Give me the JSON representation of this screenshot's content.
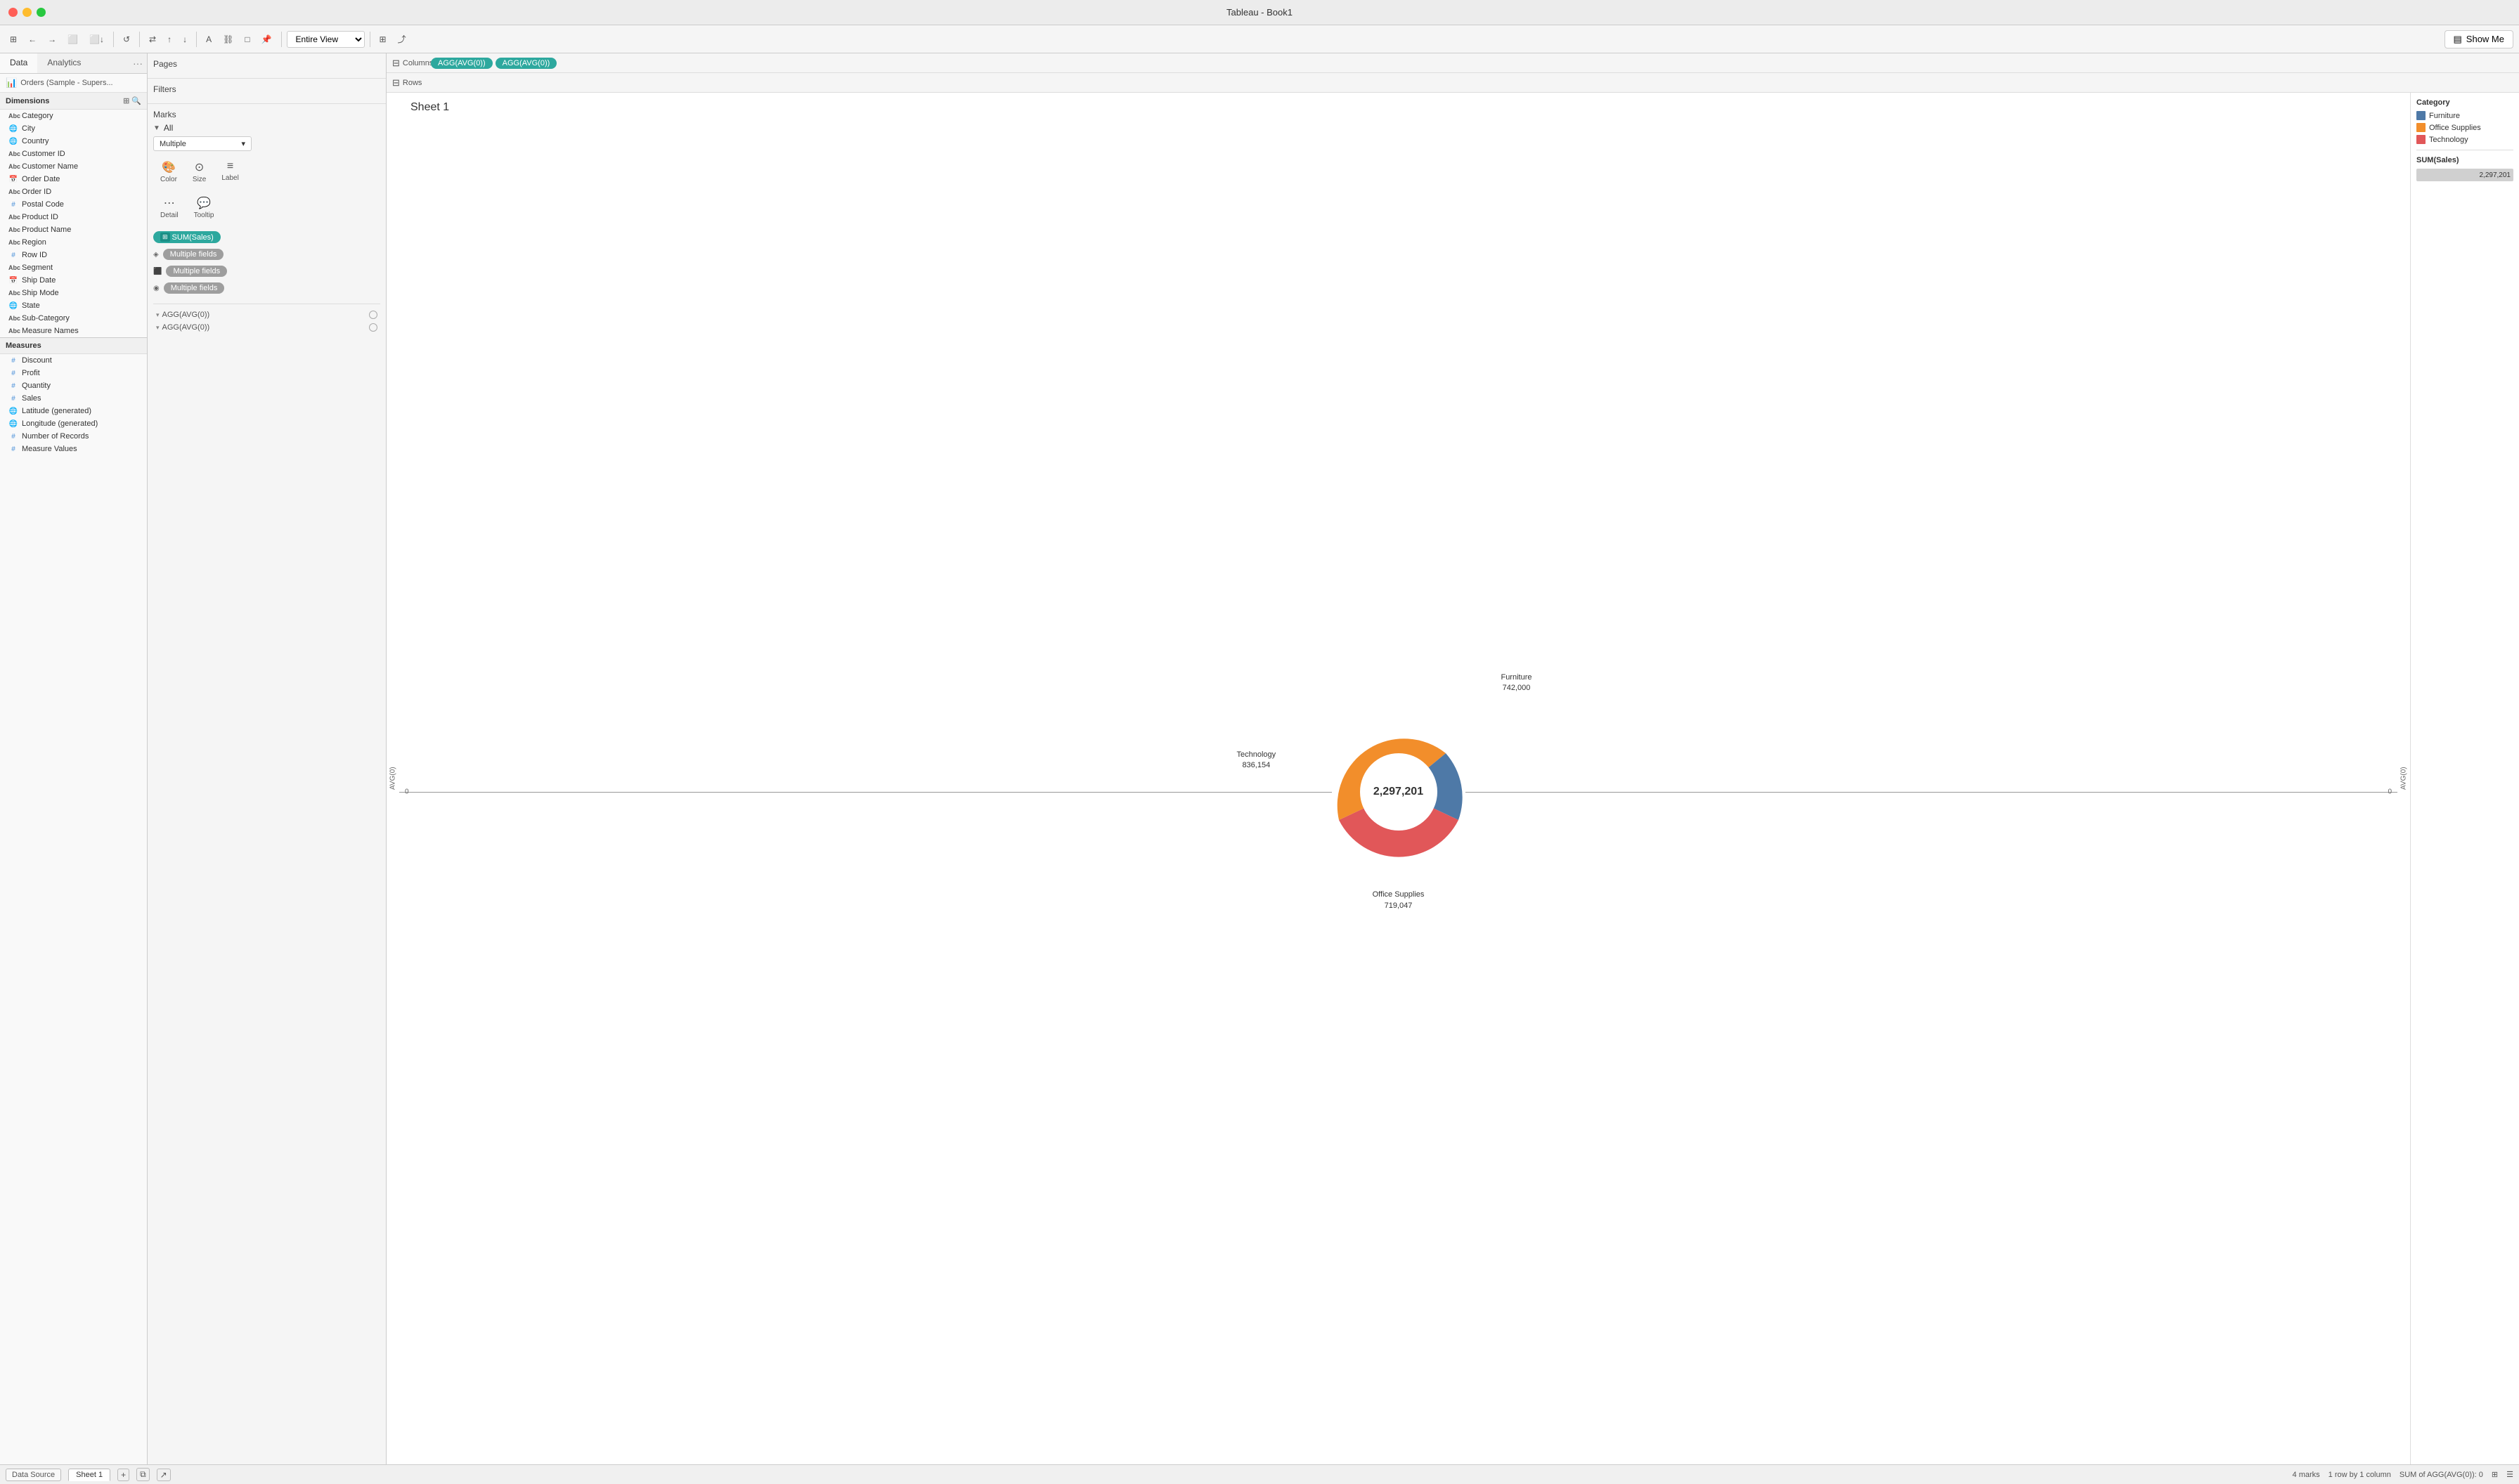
{
  "window": {
    "title": "Tableau - Book1"
  },
  "tabs": {
    "data_label": "Data",
    "analytics_label": "Analytics"
  },
  "data_source": {
    "name": "Orders (Sample - Supers..."
  },
  "dimensions": {
    "header": "Dimensions",
    "items": [
      {
        "type": "abc",
        "label": "Category"
      },
      {
        "type": "globe",
        "label": "City"
      },
      {
        "type": "globe",
        "label": "Country"
      },
      {
        "type": "abc",
        "label": "Customer ID"
      },
      {
        "type": "abc",
        "label": "Customer Name"
      },
      {
        "type": "calendar",
        "label": "Order Date"
      },
      {
        "type": "abc",
        "label": "Order ID"
      },
      {
        "type": "hash-blue",
        "label": "Postal Code"
      },
      {
        "type": "abc",
        "label": "Product ID"
      },
      {
        "type": "abc",
        "label": "Product Name"
      },
      {
        "type": "abc",
        "label": "Region"
      },
      {
        "type": "hash-blue",
        "label": "Row ID"
      },
      {
        "type": "abc",
        "label": "Segment"
      },
      {
        "type": "calendar",
        "label": "Ship Date"
      },
      {
        "type": "abc",
        "label": "Ship Mode"
      },
      {
        "type": "globe",
        "label": "State"
      },
      {
        "type": "abc",
        "label": "Sub-Category"
      },
      {
        "type": "abc",
        "label": "Measure Names"
      }
    ]
  },
  "measures": {
    "header": "Measures",
    "items": [
      {
        "type": "hash",
        "label": "Discount"
      },
      {
        "type": "hash",
        "label": "Profit"
      },
      {
        "type": "hash",
        "label": "Quantity"
      },
      {
        "type": "hash",
        "label": "Sales"
      },
      {
        "type": "globe-green",
        "label": "Latitude (generated)"
      },
      {
        "type": "globe-green",
        "label": "Longitude (generated)"
      },
      {
        "type": "hash",
        "label": "Number of Records"
      },
      {
        "type": "hash",
        "label": "Measure Values"
      }
    ]
  },
  "pages": {
    "label": "Pages"
  },
  "filters": {
    "label": "Filters"
  },
  "marks": {
    "label": "Marks",
    "all_label": "All",
    "dropdown_value": "Multiple",
    "buttons": [
      {
        "label": "Color",
        "icon": "🎨"
      },
      {
        "label": "Size",
        "icon": "⊙"
      },
      {
        "label": "Label",
        "icon": "≡"
      },
      {
        "label": "Detail",
        "icon": "⋯"
      },
      {
        "label": "Tooltip",
        "icon": "💬"
      }
    ],
    "pills": [
      {
        "label": "SUM(Sales)",
        "type": "filled"
      },
      {
        "label": "Multiple fields",
        "icon_type": "shape"
      },
      {
        "label": "Multiple fields",
        "icon_type": "color"
      },
      {
        "label": "Multiple fields",
        "icon_type": "detail"
      }
    ],
    "agg_rows": [
      {
        "label": "AGG(AVG(0))"
      },
      {
        "label": "AGG(AVG(0))"
      }
    ]
  },
  "shelves": {
    "columns_label": "Columns",
    "rows_label": "Rows",
    "columns_pill1": "AGG(AVG(0))",
    "columns_pill2": "AGG(AVG(0))",
    "rows_pills": []
  },
  "chart": {
    "title": "Sheet 1",
    "center_value": "2,297,201",
    "segments": [
      {
        "label": "Furniture",
        "value": "742,000",
        "color": "#4e79a7",
        "angle_start": -30,
        "angle_end": 85
      },
      {
        "label": "Technology",
        "value": "836,154",
        "color": "#e15759",
        "angle_start": 85,
        "angle_end": 215
      },
      {
        "label": "Office Supplies",
        "value": "719,047",
        "color": "#f28e2b",
        "angle_start": 215,
        "angle_end": 330
      }
    ],
    "y_axis_label": "AVG(0)"
  },
  "legend": {
    "category_title": "Category",
    "items": [
      {
        "label": "Furniture",
        "color": "#4e79a7"
      },
      {
        "label": "Office Supplies",
        "color": "#f28e2b"
      },
      {
        "label": "Technology",
        "color": "#e15759"
      }
    ],
    "sum_sales_title": "SUM(Sales)",
    "sum_sales_value": "2,297,201"
  },
  "toolbar": {
    "show_me": "Show Me",
    "view_dropdown": "Entire View"
  },
  "status_bar": {
    "marks": "4 marks",
    "rows": "1 row by 1 column",
    "sum_info": "SUM of AGG(AVG(0)): 0",
    "data_source": "Data Source",
    "sheet1": "Sheet 1"
  }
}
